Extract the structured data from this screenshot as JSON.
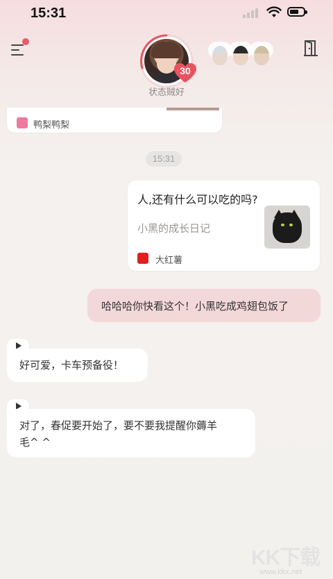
{
  "status_bar": {
    "time": "15:31"
  },
  "header": {
    "affection_level": "30",
    "status_text": "状态贼好"
  },
  "top_card": {
    "source_label": "鸭梨鸭梨",
    "source_color": "#ee7aa0"
  },
  "chat": {
    "timestamp": "15:31",
    "share_card": {
      "title": "人,还有什么可以吃的吗?",
      "subtitle": "小黑的成长日记",
      "source_label": "大红薯",
      "source_color": "#e02020"
    },
    "sent_message": "哈哈哈你快看这个！小黑吃成鸡翅包饭了",
    "received": [
      {
        "lines": [
          "好可爱，卡车预备役！"
        ]
      },
      {
        "lines": [
          "对了，春促要开始了，要不要我提醒你薅羊",
          "毛^ ^"
        ]
      }
    ]
  },
  "watermark": {
    "big": "KK下载",
    "small": "www.kkx.net"
  },
  "colors": {
    "accent": "#ea5a6a",
    "sent_bubble": "#f3d8da"
  }
}
